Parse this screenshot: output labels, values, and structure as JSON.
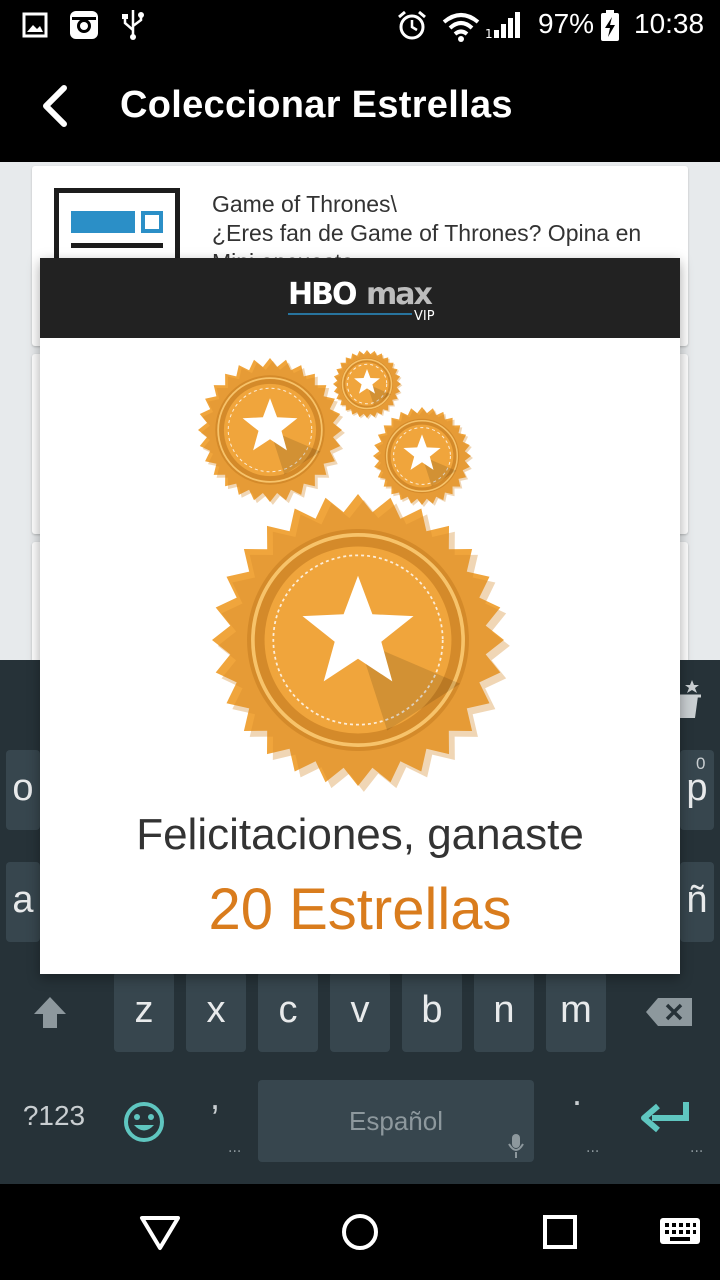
{
  "status_bar": {
    "battery": "97%",
    "time": "10:38",
    "icons": [
      "image-icon",
      "instagram-icon",
      "usb-icon",
      "alarm-icon",
      "wifi-icon",
      "signal-icon",
      "battery-charging-icon"
    ]
  },
  "app_bar": {
    "title": "Coleccionar Estrellas",
    "back_icon": "back-arrow-icon"
  },
  "list": {
    "items": [
      {
        "text": "Game of Thrones\\\n¿Eres fan de Game of Thrones? Opina en\nMini encuesta"
      }
    ]
  },
  "dialog": {
    "brand": {
      "hbo": "HBO",
      "max": "max",
      "tier": "VIP"
    },
    "message": "Felicitaciones, ganaste",
    "reward": "20 Estrellas",
    "colors": {
      "reward": "#d97c1d",
      "medal": "#f0a53c",
      "medal_dark": "#d48a2a"
    }
  },
  "keyboard": {
    "row2_visible_left": "o",
    "row2_visible_right": "p",
    "row2_hint": "0",
    "row3_visible_left": "a",
    "row3_visible_right": "ñ",
    "row4": [
      "z",
      "x",
      "c",
      "v",
      "b",
      "n",
      "m"
    ],
    "symbols_label": "?123",
    "comma": ",",
    "space_label": "Español",
    "period": ".",
    "ellipsis": "...",
    "colors": {
      "background": "#263238",
      "key": "#37464e",
      "accent": "#5fc6c0"
    }
  },
  "nav_bar": {
    "icons": [
      "back-triangle-icon",
      "home-circle-icon",
      "recents-square-icon",
      "keyboard-switch-icon"
    ]
  }
}
